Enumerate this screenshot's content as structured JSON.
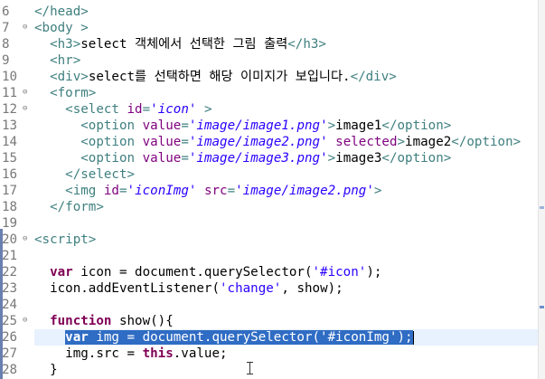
{
  "editor": {
    "lines": [
      {
        "n": "6",
        "fold": "",
        "tokens": [
          [
            "tag",
            "</head>"
          ]
        ]
      },
      {
        "n": "7",
        "fold": "⊖",
        "tokens": [
          [
            "tag",
            "<body >"
          ]
        ]
      },
      {
        "n": "8",
        "fold": "",
        "tokens": [
          [
            "text",
            "  "
          ],
          [
            "tag",
            "<h3>"
          ],
          [
            "text",
            "select 객체에서 선택한 그림 출력"
          ],
          [
            "tag",
            "</h3>"
          ]
        ]
      },
      {
        "n": "9",
        "fold": "",
        "tokens": [
          [
            "text",
            "  "
          ],
          [
            "tag",
            "<hr>"
          ]
        ]
      },
      {
        "n": "10",
        "fold": "",
        "tokens": [
          [
            "text",
            "  "
          ],
          [
            "tag",
            "<div>"
          ],
          [
            "text",
            "select를 선택하면 해당 이미지가 보입니다."
          ],
          [
            "tag",
            "</div>"
          ]
        ]
      },
      {
        "n": "11",
        "fold": "⊖",
        "tokens": [
          [
            "text",
            "  "
          ],
          [
            "tag",
            "<form>"
          ]
        ]
      },
      {
        "n": "12",
        "fold": "⊖",
        "tokens": [
          [
            "text",
            "    "
          ],
          [
            "tag",
            "<select "
          ],
          [
            "attr",
            "id"
          ],
          [
            "tag",
            "="
          ],
          [
            "str",
            "'icon'"
          ],
          [
            "tag",
            " >"
          ]
        ]
      },
      {
        "n": "13",
        "fold": "",
        "tokens": [
          [
            "text",
            "      "
          ],
          [
            "tag",
            "<option "
          ],
          [
            "attr",
            "value"
          ],
          [
            "tag",
            "="
          ],
          [
            "str",
            "'image/image1.png'"
          ],
          [
            "tag",
            ">"
          ],
          [
            "text",
            "image1"
          ],
          [
            "tag",
            "</option>"
          ]
        ]
      },
      {
        "n": "14",
        "fold": "",
        "tokens": [
          [
            "text",
            "      "
          ],
          [
            "tag",
            "<option "
          ],
          [
            "attr",
            "value"
          ],
          [
            "tag",
            "="
          ],
          [
            "str",
            "'image/image2.png'"
          ],
          [
            "tag",
            " "
          ],
          [
            "attr",
            "selected"
          ],
          [
            "tag",
            ">"
          ],
          [
            "text",
            "image2"
          ],
          [
            "tag",
            "</option>"
          ]
        ]
      },
      {
        "n": "15",
        "fold": "",
        "tokens": [
          [
            "text",
            "      "
          ],
          [
            "tag",
            "<option "
          ],
          [
            "attr",
            "value"
          ],
          [
            "tag",
            "="
          ],
          [
            "str",
            "'image/image3.png'"
          ],
          [
            "tag",
            ">"
          ],
          [
            "text",
            "image3"
          ],
          [
            "tag",
            "</option>"
          ]
        ]
      },
      {
        "n": "16",
        "fold": "",
        "tokens": [
          [
            "text",
            "    "
          ],
          [
            "tag",
            "</select>"
          ]
        ]
      },
      {
        "n": "17",
        "fold": "",
        "tokens": [
          [
            "text",
            "    "
          ],
          [
            "tag",
            "<img "
          ],
          [
            "attr",
            "id"
          ],
          [
            "tag",
            "="
          ],
          [
            "str",
            "'iconImg'"
          ],
          [
            "tag",
            " "
          ],
          [
            "attr",
            "src"
          ],
          [
            "tag",
            "="
          ],
          [
            "str",
            "'image/image2.png'"
          ],
          [
            "tag",
            ">"
          ]
        ]
      },
      {
        "n": "18",
        "fold": "",
        "tokens": [
          [
            "text",
            "  "
          ],
          [
            "tag",
            "</form>"
          ]
        ]
      },
      {
        "n": "19",
        "fold": "",
        "tokens": []
      },
      {
        "n": "20",
        "fold": "⊖",
        "tokens": [
          [
            "tag",
            "<script>"
          ]
        ]
      },
      {
        "n": "21",
        "fold": "",
        "tokens": []
      },
      {
        "n": "22",
        "fold": "",
        "tokens": [
          [
            "text",
            "  "
          ],
          [
            "kw",
            "var"
          ],
          [
            "js",
            " icon = document.querySelector("
          ],
          [
            "jsstr",
            "'#icon'"
          ],
          [
            "js",
            ");"
          ]
        ]
      },
      {
        "n": "23",
        "fold": "",
        "tokens": [
          [
            "text",
            "  "
          ],
          [
            "js",
            "icon.addEventListener("
          ],
          [
            "jsstr",
            "'change'"
          ],
          [
            "js",
            ", show);"
          ]
        ]
      },
      {
        "n": "24",
        "fold": "",
        "tokens": []
      },
      {
        "n": "25",
        "fold": "⊖",
        "tokens": [
          [
            "text",
            "  "
          ],
          [
            "kw",
            "function"
          ],
          [
            "js",
            " show(){"
          ]
        ]
      },
      {
        "n": "26",
        "fold": "",
        "tokens": [
          [
            "text",
            "    "
          ],
          [
            "sel_start",
            ""
          ],
          [
            "kw",
            "var"
          ],
          [
            "js",
            " img = document.querySelector("
          ],
          [
            "jsstr",
            "'#iconImg'"
          ],
          [
            "js",
            ");"
          ],
          [
            "sel_end",
            ""
          ]
        ]
      },
      {
        "n": "27",
        "fold": "",
        "tokens": [
          [
            "text",
            "    "
          ],
          [
            "js",
            "img.src = "
          ],
          [
            "kw",
            "this"
          ],
          [
            "js",
            ".value;"
          ]
        ]
      },
      {
        "n": "28",
        "fold": "",
        "tokens": [
          [
            "text",
            "  "
          ],
          [
            "js",
            "}"
          ]
        ]
      }
    ],
    "current_line": "26",
    "colors": {
      "tag": "#3f7f7f",
      "attribute": "#7f007f",
      "string": "#2a00ff",
      "keyword": "#7f0055",
      "selection": "#2f6cc4",
      "current_line": "#e8f2fe"
    }
  }
}
